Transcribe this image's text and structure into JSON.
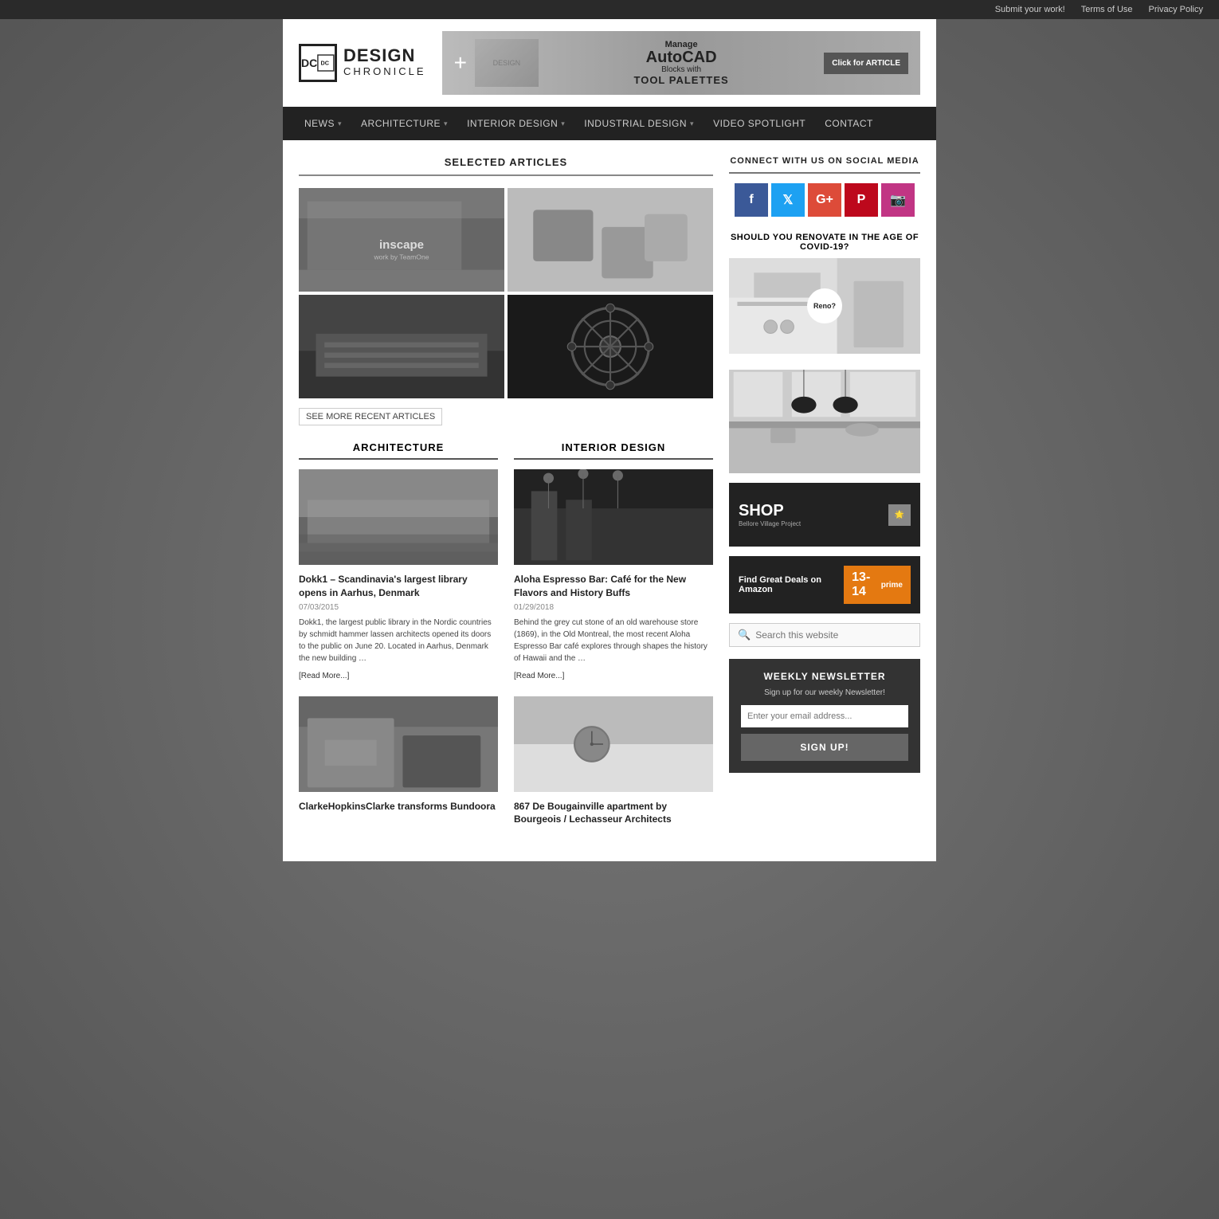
{
  "topbar": {
    "links": [
      {
        "label": "Submit your work!",
        "href": "#"
      },
      {
        "label": "Terms of Use",
        "href": "#"
      },
      {
        "label": "Privacy Policy",
        "href": "#"
      }
    ]
  },
  "header": {
    "logo": {
      "initials": "DC",
      "title": "DESIGN",
      "subtitle": "CHRONICLE"
    },
    "banner": {
      "manage": "Manage",
      "autocad": "AutoCAD",
      "blocks_with": "Blocks with",
      "tool_palettes": "TOOL PALETTES",
      "cta": "Click for ARTICLE"
    }
  },
  "nav": {
    "items": [
      {
        "label": "NEWS",
        "has_dropdown": true
      },
      {
        "label": "ARCHITECTURE",
        "has_dropdown": true
      },
      {
        "label": "INTERIOR DESIGN",
        "has_dropdown": true
      },
      {
        "label": "INDUSTRIAL DESIGN",
        "has_dropdown": true
      },
      {
        "label": "VIDEO SPOTLIGHT",
        "has_dropdown": false
      },
      {
        "label": "CONTACT",
        "has_dropdown": false
      }
    ]
  },
  "selected_articles": {
    "title": "SELECTED ARTICLES",
    "see_more": "SEE MORE RECENT ARTICLES",
    "images": [
      {
        "alt": "Office interior with inscape branding",
        "label": "inscape"
      },
      {
        "alt": "Stone blocks sculpture"
      },
      {
        "alt": "Night building architecture"
      },
      {
        "alt": "Gear sphere sculpture"
      }
    ]
  },
  "architecture": {
    "title": "ARCHITECTURE",
    "articles": [
      {
        "title": "Dokk1 – Scandinavia's largest library opens in Aarhus, Denmark",
        "date": "07/03/2015",
        "excerpt": "Dokk1, the largest public library in the Nordic countries by schmidt hammer lassen architects opened its doors to the public on June 20. Located in Aarhus, Denmark the new building …",
        "read_more": "[Read More...]"
      },
      {
        "title": "ClarkeHopkinsClarke transforms Bundoora",
        "date": "",
        "excerpt": "",
        "read_more": ""
      }
    ]
  },
  "interior_design": {
    "title": "INTERIOR DESIGN",
    "articles": [
      {
        "title": "Aloha Espresso Bar: Café for the New Flavors and History Buffs",
        "date": "01/29/2018",
        "excerpt": "Behind the grey cut stone of an old warehouse store (1869), in the Old Montreal, the most recent Aloha Espresso Bar café explores through shapes the history of Hawaii and the …",
        "read_more": "[Read More...]"
      },
      {
        "title": "867 De Bougainville apartment by Bourgeois / Lechasseur Architects",
        "date": "",
        "excerpt": "",
        "read_more": ""
      }
    ]
  },
  "sidebar": {
    "social": {
      "title": "CONNECT WITH US ON SOCIAL MEDIA",
      "platforms": [
        "f",
        "𝕏",
        "G+",
        "P",
        "📷"
      ]
    },
    "renovate": {
      "question": "SHOULD YOU RENOVATE IN THE AGE OF COVID-19?",
      "badge": "Reno?"
    },
    "shop": {
      "title": "SHOP",
      "subtitle": "Bellore Village Project",
      "amazon_text": "Find Great Deals on Amazon",
      "badge": "13-14"
    },
    "search": {
      "placeholder": "Search this website"
    },
    "newsletter": {
      "title": "WEEKLY NEWSLETTER",
      "subtitle": "Sign up for our weekly Newsletter!",
      "email_placeholder": "Enter your email address...",
      "button": "SIGN UP!"
    }
  }
}
